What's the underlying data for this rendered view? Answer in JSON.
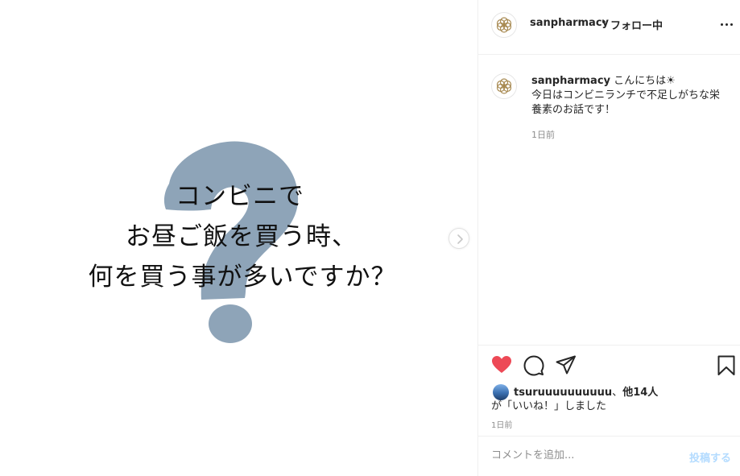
{
  "media": {
    "text_line1": "コンビニで",
    "text_line2": "お昼ご飯を買う時、",
    "text_line3": "何を買う事が多いですか？",
    "question_mark_color": "#8ea4b8"
  },
  "header": {
    "username": "sanpharmacy",
    "separator": "•",
    "follow_status": "フォロー中"
  },
  "caption": {
    "username": "sanpharmacy",
    "text_part1": "こんにちは",
    "sun_emoji": "☀",
    "text_part2": "今日はコンビニランチで不足しがちな栄養素のお話です！",
    "timestamp": "1日前"
  },
  "likes": {
    "liker": "tsuruuuuuuuuuu",
    "others_sep": "、",
    "others": "他14人",
    "suffix": "が「いいね！」しました"
  },
  "post_timestamp": "1日前",
  "comment": {
    "placeholder": "コメントを追加...",
    "post_label": "投稿する"
  },
  "colors": {
    "like_red": "#ed4956",
    "post_button_disabled": "#b3dbff",
    "logo_gold": "#a88a52"
  }
}
